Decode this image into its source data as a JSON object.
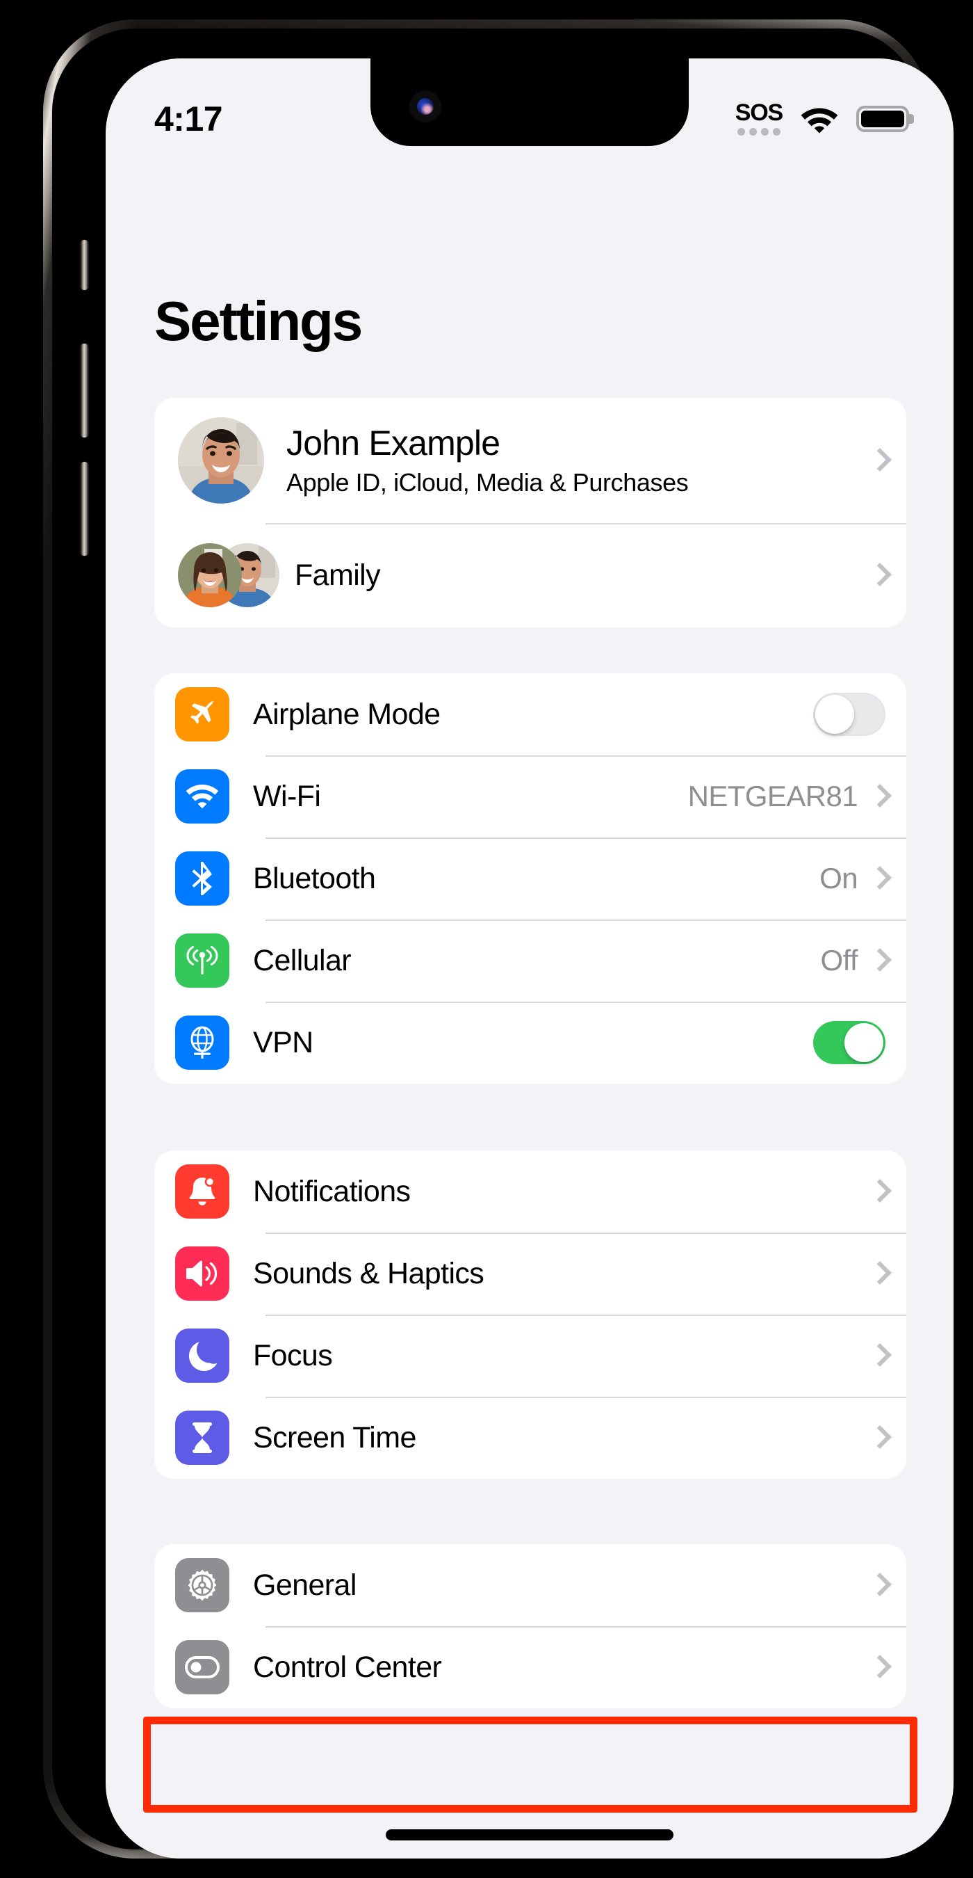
{
  "status_bar": {
    "time": "4:17",
    "sos_label": "SOS",
    "sos_dots": 4,
    "wifi_icon": "wifi-icon",
    "battery_icon": "battery-full-icon"
  },
  "header": {
    "title": "Settings"
  },
  "account_group": {
    "apple_id": {
      "name": "John Example",
      "subtitle": "Apple ID, iCloud, Media & Purchases",
      "avatar": "user-photo-avatar",
      "chevron": "chevron-right-icon"
    },
    "family": {
      "label": "Family",
      "avatars": "family-photos-avatar",
      "chevron": "chevron-right-icon"
    }
  },
  "connectivity_group": {
    "rows": [
      {
        "label": "Airplane Mode",
        "icon": "airplane-icon",
        "icon_color": "#ff9500",
        "control": "toggle",
        "toggle_on": false
      },
      {
        "label": "Wi-Fi",
        "icon": "wifi-icon",
        "icon_color": "#007aff",
        "control": "value",
        "value": "NETGEAR81"
      },
      {
        "label": "Bluetooth",
        "icon": "bluetooth-icon",
        "icon_color": "#007aff",
        "control": "value",
        "value": "On"
      },
      {
        "label": "Cellular",
        "icon": "cellular-antenna-icon",
        "icon_color": "#34c759",
        "control": "value",
        "value": "Off"
      },
      {
        "label": "VPN",
        "icon": "vpn-globe-icon",
        "icon_color": "#007aff",
        "control": "toggle",
        "toggle_on": true
      }
    ]
  },
  "alerts_group": {
    "rows": [
      {
        "label": "Notifications",
        "icon": "bell-icon",
        "icon_color": "#ff3b30"
      },
      {
        "label": "Sounds & Haptics",
        "icon": "speaker-icon",
        "icon_color": "#ff2d55"
      },
      {
        "label": "Focus",
        "icon": "moon-icon",
        "icon_color": "#5e5ce6"
      },
      {
        "label": "Screen Time",
        "icon": "hourglass-icon",
        "icon_color": "#5e5ce6"
      }
    ]
  },
  "system_group": {
    "rows": [
      {
        "label": "General",
        "icon": "gear-icon",
        "icon_color": "#8e8e93",
        "highlighted": true
      },
      {
        "label": "Control Center",
        "icon": "control-toggle-icon",
        "icon_color": "#8e8e93",
        "highlighted": false
      }
    ]
  },
  "annotation": {
    "target": "General",
    "color": "#fc2b05"
  },
  "colors": {
    "screen_background": "#f2f2f7",
    "cell_background": "#ffffff",
    "secondary_text": "#8e8e93",
    "separator": "#d9d9dd",
    "toggle_on": "#34c759",
    "toggle_off": "#e9e9eb",
    "chevron": "#c1c1c6",
    "highlight": "#fc2b05"
  }
}
